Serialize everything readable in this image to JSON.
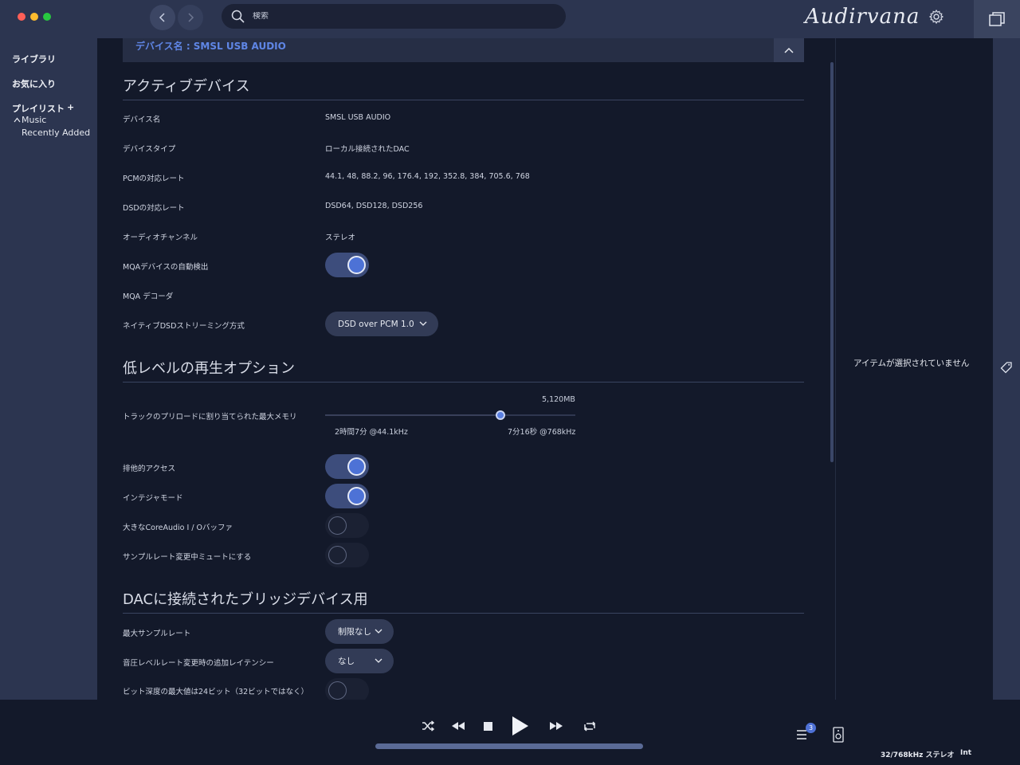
{
  "titlebar": {
    "search_placeholder": "検索",
    "logo": "Audirvana",
    "colors": {
      "close": "#fe5f57",
      "minimize": "#febc2e",
      "maximize": "#28c840"
    }
  },
  "sidebar": {
    "library": "ライブラリ",
    "favorites": "お気に入り",
    "playlists": "プレイリスト",
    "add_playlist": "+",
    "music_folder": "Music",
    "recently_added": "Recently Added"
  },
  "device_header": "デバイス名 : SMSL USB AUDIO",
  "active_device": {
    "title": "アクティブデバイス",
    "rows": [
      {
        "label": "デバイス名",
        "value": "SMSL USB AUDIO"
      },
      {
        "label": "デバイスタイプ",
        "value": "ローカル接続されたDAC"
      },
      {
        "label": "PCMの対応レート",
        "value": "44.1, 48, 88.2, 96, 176.4, 192, 352.8, 384, 705.6, 768"
      },
      {
        "label": "DSDの対応レート",
        "value": "DSD64, DSD128, DSD256"
      },
      {
        "label": "オーディオチャンネル",
        "value": "ステレオ"
      }
    ],
    "mqa_auto_detect": {
      "label": "MQAデバイスの自動検出",
      "on": true
    },
    "mqa_decoder": {
      "label": "MQA デコーダ"
    },
    "native_dsd": {
      "label": "ネイティブDSDストリーミング方式",
      "value": "DSD over PCM 1.0"
    }
  },
  "low_level": {
    "title": "低レベルの再生オプション",
    "preload": {
      "label": "トラックのプリロードに割り当てられた最大メモリ",
      "value": "5,120MB",
      "position_fraction": 0.7,
      "left_caption": "2時間7分 @44.1kHz",
      "right_caption": "7分16秒 @768kHz"
    },
    "exclusive_access": {
      "label": "排他的アクセス",
      "on": true
    },
    "integer_mode": {
      "label": "インテジャモード",
      "on": true
    },
    "large_buffer": {
      "label": "大きなCoreAudio I / Oバッファ",
      "on": false
    },
    "mute_on_rate_change": {
      "label": "サンプルレート変更中ミュートにする",
      "on": false
    }
  },
  "bridge": {
    "title": "DACに接続されたブリッジデバイス用",
    "max_rate": {
      "label": "最大サンプルレート",
      "value": "制限なし"
    },
    "latency": {
      "label": "音圧レベルレート変更時の追加レイテンシー",
      "value": "なし"
    },
    "max_bit_depth": {
      "label": "ビット深度の最大値は24ビット（32ビットではなく）",
      "on": false
    }
  },
  "right_panel": {
    "message": "アイテムが選択されていません"
  },
  "player": {
    "queue_count": "3",
    "format": "32/768kHz ステレオ",
    "output": "Int"
  }
}
